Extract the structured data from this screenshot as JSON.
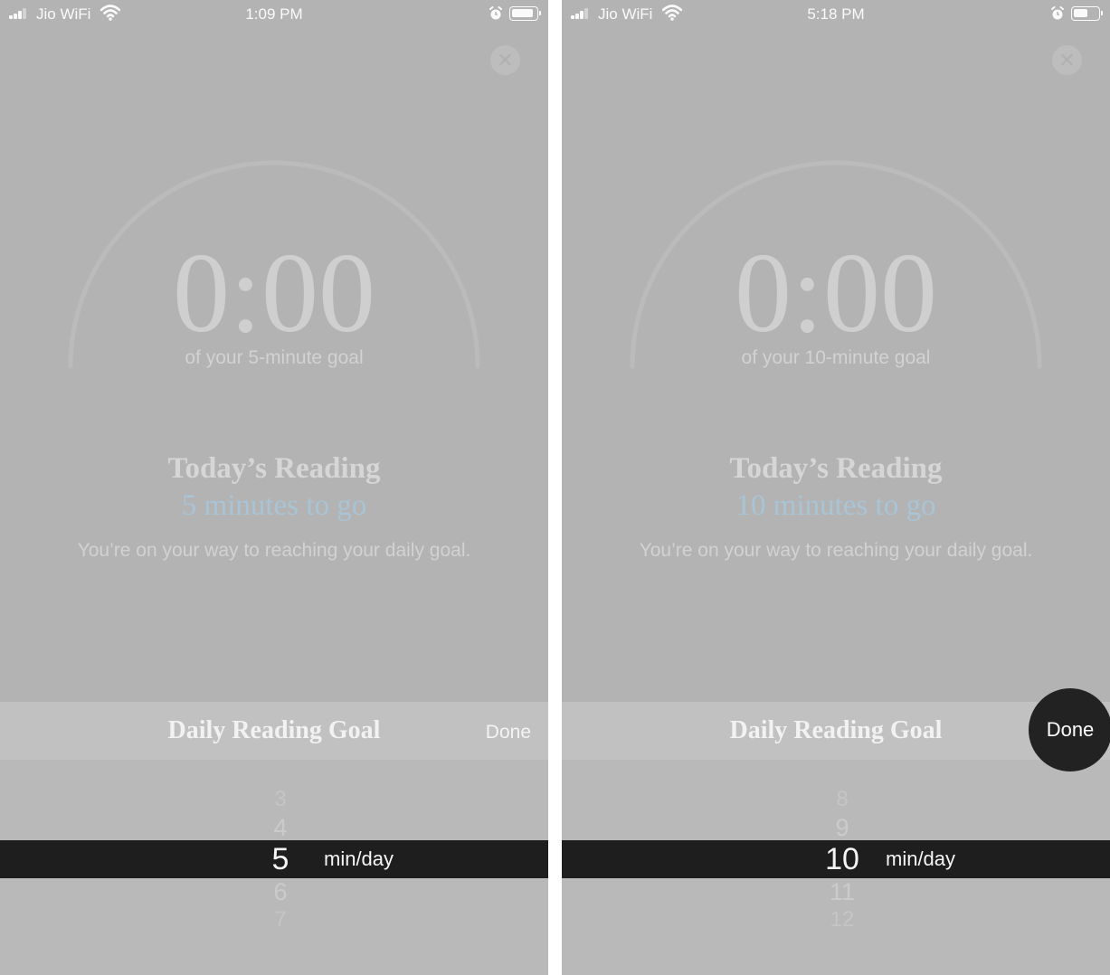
{
  "panels": [
    {
      "status": {
        "carrier": "Jio WiFi",
        "time": "1:09 PM",
        "battery_level": 0.9
      },
      "timer": "0:00",
      "goal_subtitle": "of your 5-minute goal",
      "reading_title": "Today’s Reading",
      "reading_remaining": "5 minutes to go",
      "reading_description": "You’re on your way to reaching your daily goal.",
      "sheet": {
        "title": "Daily Reading Goal",
        "done": "Done",
        "done_highlighted": false,
        "picker_above": [
          "3",
          "4"
        ],
        "picker_selected": "5",
        "picker_below": [
          "6",
          "7"
        ],
        "unit": "min/day"
      }
    },
    {
      "status": {
        "carrier": "Jio WiFi",
        "time": "5:18 PM",
        "battery_level": 0.6
      },
      "timer": "0:00",
      "goal_subtitle": "of your 10-minute goal",
      "reading_title": "Today’s Reading",
      "reading_remaining": "10 minutes to go",
      "reading_description": "You’re on your way to reaching your daily goal.",
      "sheet": {
        "title": "Daily Reading Goal",
        "done": "Done",
        "done_highlighted": true,
        "picker_above": [
          "8",
          "9"
        ],
        "picker_selected": "10",
        "picker_below": [
          "11",
          "12"
        ],
        "unit": "min/day"
      }
    }
  ]
}
